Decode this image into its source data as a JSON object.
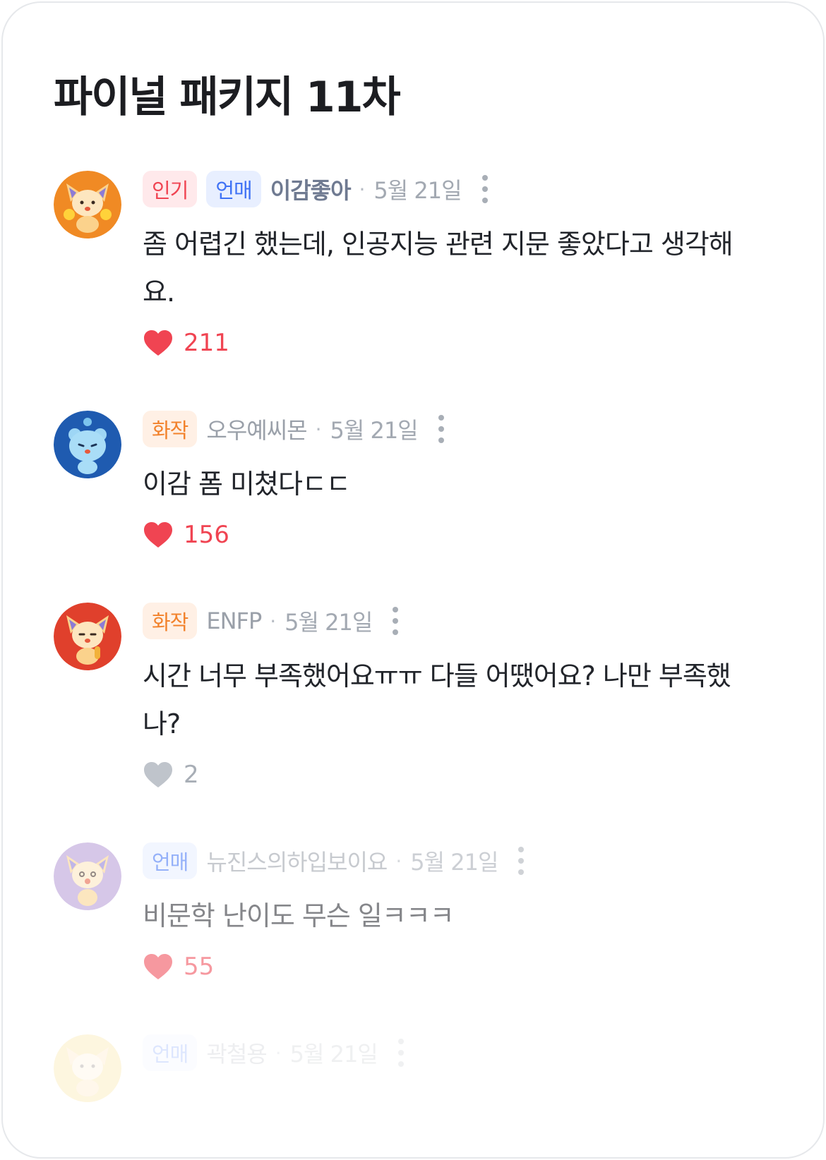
{
  "title": "파이널 패키지 11차",
  "comments": [
    {
      "badges": [
        "인기",
        "언매"
      ],
      "author": "이감좋아",
      "dot": "·",
      "date": "5월 21일",
      "text": "좀 어렵긴 했는데, 인공지능 관련 지문 좋았다고 생각해요.",
      "likes": "211",
      "avatar_icon": "fox-cheerleader-avatar",
      "avatar_color": "#f08a24"
    },
    {
      "badges": [
        "화작"
      ],
      "author": "오우예씨몬",
      "dot": "·",
      "date": "5월 21일",
      "text": "이감 폼 미쳤다ㄷㄷ",
      "likes": "156",
      "avatar_icon": "blue-bear-avatar",
      "avatar_color": "#1f5bb0"
    },
    {
      "badges": [
        "화작"
      ],
      "author": "ENFP",
      "dot": "·",
      "date": "5월 21일",
      "text": "시간 너무 부족했어요ㅠㅠ 다들 어땠어요? 나만 부족했나?",
      "likes": "2",
      "avatar_icon": "fox-microphone-avatar",
      "avatar_color": "#e0402c"
    },
    {
      "badges": [
        "언매"
      ],
      "author": "뉴진스의하입보이요",
      "dot": "·",
      "date": "5월 21일",
      "text": "비문학 난이도 무슨 일ㅋㅋㅋ",
      "likes": "55",
      "avatar_icon": "fox-lavender-avatar",
      "avatar_color": "#b69ad6"
    },
    {
      "badges": [
        "언매"
      ],
      "author": "곽철용",
      "dot": "·",
      "date": "5월 21일",
      "avatar_icon": "fox-yellow-avatar",
      "avatar_color": "#f2c94c"
    }
  ]
}
